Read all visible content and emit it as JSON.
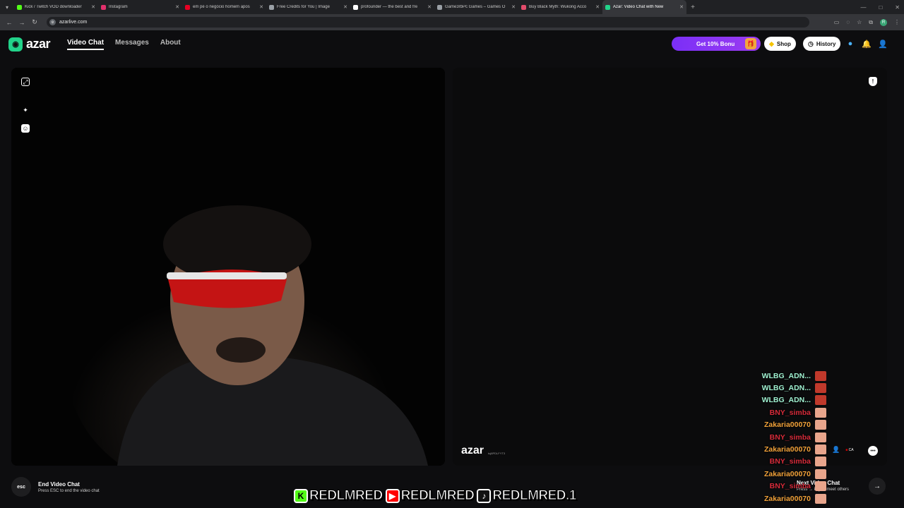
{
  "browser": {
    "tabs": [
      {
        "label": "Kick / Twitch VOD downloader",
        "color": "#53fc18",
        "active": false
      },
      {
        "label": "Instagram",
        "color": "#e1306c",
        "active": false
      },
      {
        "label": "em pé o negócio homem apos",
        "color": "#e60023",
        "active": false
      },
      {
        "label": "Free Credits for You | Image",
        "color": "#9aa0a6",
        "active": false
      },
      {
        "label": "profounder — the best and fre",
        "color": "#ffffff",
        "active": false
      },
      {
        "label": "Game3rbPc Games – Games O",
        "color": "#9aa0a6",
        "active": false
      },
      {
        "label": "Buy Black Myth: Wukong Acco",
        "color": "#e34c6b",
        "active": false
      },
      {
        "label": "Azar: Video Chat with New",
        "color": "#22d38a",
        "active": true
      }
    ],
    "new_tab_symbol": "+",
    "url": "azarlive.com",
    "profile_initial": "R"
  },
  "header": {
    "logo_text": "azar",
    "nav": [
      {
        "label": "Video Chat",
        "active": true
      },
      {
        "label": "Messages",
        "active": false
      },
      {
        "label": "About",
        "active": false
      }
    ],
    "promo_label": "Get 10% Bonu",
    "shop_label": "Shop",
    "history_label": "History"
  },
  "video": {
    "watermark_logo": "azar",
    "watermark_id": "tuj8PDLFYT3"
  },
  "footer": {
    "esc_key": "esc",
    "end_title": "End Video Chat",
    "end_subtitle": "Press ESC to end the video chat",
    "next_title": "Next Video Chat",
    "next_subtitle": "Press → key to meet others",
    "country": "CA"
  },
  "overlay_feed": [
    {
      "name": "WLBG_ADN...",
      "color": "#9ff0d0",
      "avatar": "#c0392b"
    },
    {
      "name": "WLBG_ADN...",
      "color": "#9ff0d0",
      "avatar": "#c0392b"
    },
    {
      "name": "WLBG_ADN...",
      "color": "#9ff0d0",
      "avatar": "#c0392b"
    },
    {
      "name": "BNY_simba",
      "color": "#d62b3a",
      "avatar": "#e8a58c"
    },
    {
      "name": "Zakaria00070",
      "color": "#f2a23a",
      "avatar": "#e8a58c"
    },
    {
      "name": "BNY_simba",
      "color": "#d62b3a",
      "avatar": "#e8a58c"
    },
    {
      "name": "Zakaria00070",
      "color": "#f2a23a",
      "avatar": "#e8a58c"
    },
    {
      "name": "BNY_simba",
      "color": "#d62b3a",
      "avatar": "#e8a58c"
    },
    {
      "name": "Zakaria00070",
      "color": "#f2a23a",
      "avatar": "#e8a58c"
    },
    {
      "name": "BNY_simba",
      "color": "#d62b3a",
      "avatar": "#e8a58c"
    },
    {
      "name": "Zakaria00070",
      "color": "#f2a23a",
      "avatar": "#e8a58c"
    }
  ],
  "socials": [
    {
      "icon": "kick-icon",
      "glyph": "K",
      "bg": "#53fc18",
      "fg": "#000",
      "handle": "REDLMRED"
    },
    {
      "icon": "youtube-icon",
      "glyph": "▶",
      "bg": "#ff0000",
      "fg": "#fff",
      "handle": "REDLMRED"
    },
    {
      "icon": "tiktok-icon",
      "glyph": "♪",
      "bg": "#111",
      "fg": "#fff",
      "handle": "REDLMRED.1"
    }
  ]
}
